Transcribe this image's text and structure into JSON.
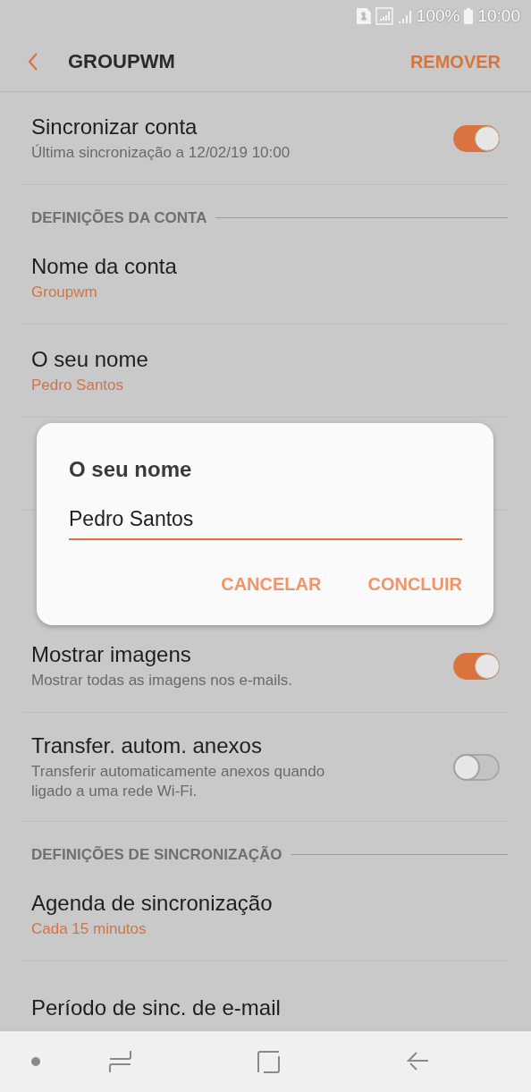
{
  "status_bar": {
    "sim_slot": "1",
    "battery": "100%",
    "time": "10:00"
  },
  "header": {
    "title": "GROUPWM",
    "action": "REMOVER"
  },
  "settings": [
    {
      "kind": "toggle",
      "title": "Sincronizar conta",
      "subtitle": [
        "Última sincronização a 12/02/19  10:00"
      ],
      "on": true
    },
    {
      "kind": "section",
      "title": "DEFINIÇÕES DA CONTA"
    },
    {
      "kind": "value",
      "title": "Nome da conta",
      "subtitle": [
        "Groupwm"
      ]
    },
    {
      "kind": "value",
      "title": "O seu nome",
      "subtitle": [
        "Pedro Santos"
      ]
    },
    {
      "kind": "covered"
    },
    {
      "kind": "toggle",
      "title": "Mostrar imagens",
      "subtitle": [
        "Mostrar todas as imagens nos e-mails."
      ],
      "on": true
    },
    {
      "kind": "toggle",
      "title": "Transfer. autom. anexos",
      "subtitle": [
        "Transferir automaticamente anexos quando",
        "ligado a uma rede Wi-Fi."
      ],
      "on": false
    },
    {
      "kind": "section",
      "title": "DEFINIÇÕES DE SINCRONIZAÇÃO"
    },
    {
      "kind": "value",
      "title": "Agenda de sincronização",
      "subtitle": [
        "Cada 15 minutos"
      ]
    },
    {
      "kind": "value",
      "title": "Período de sinc. de e-mail"
    }
  ],
  "dialog": {
    "title": "O seu nome",
    "value": "Pedro Santos",
    "buttons": [
      "CANCELAR",
      "CONCLUIR"
    ]
  }
}
